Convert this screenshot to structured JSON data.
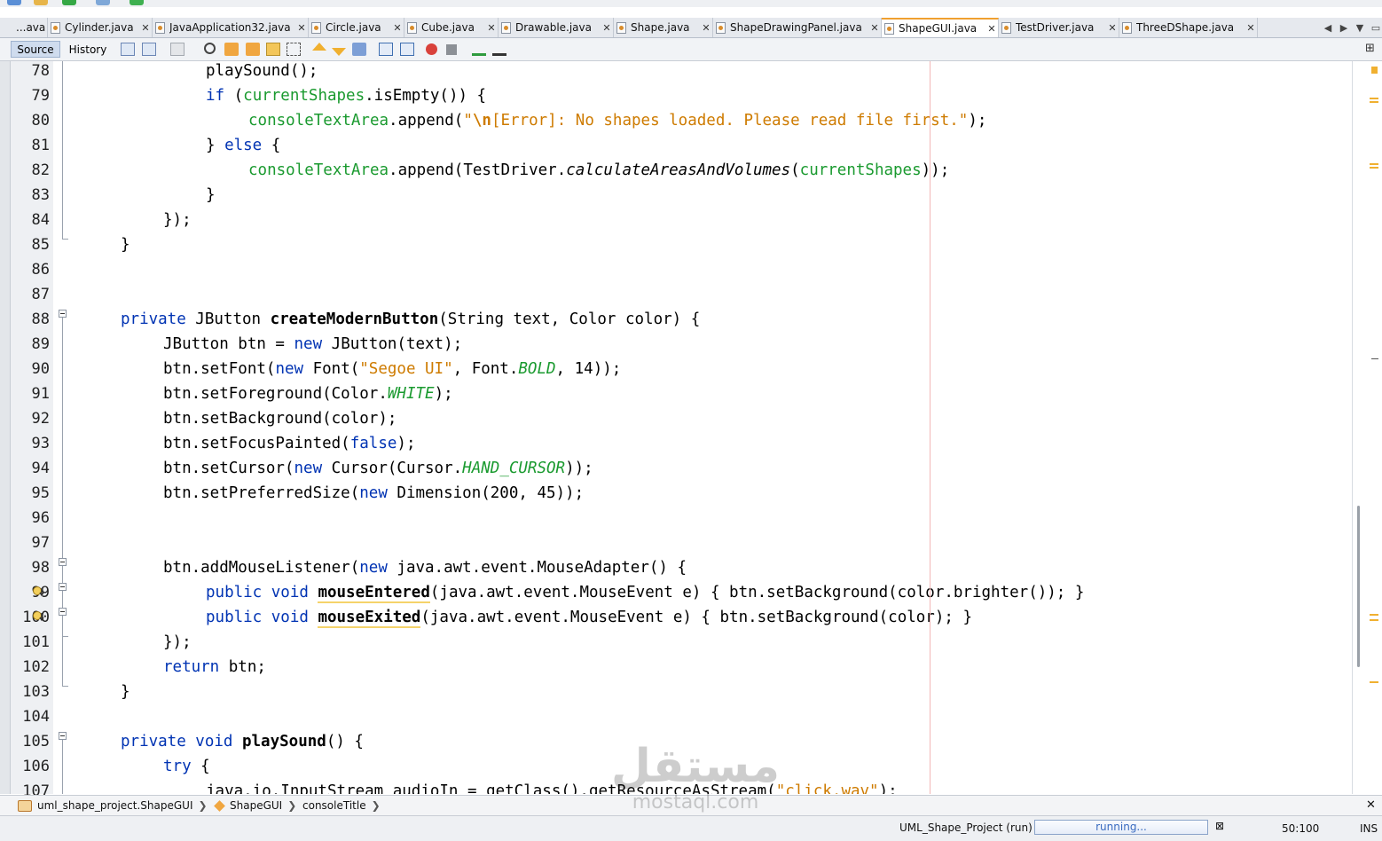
{
  "editor_tabs": [
    {
      "label": "...ava",
      "active": false
    },
    {
      "label": "Cylinder.java",
      "active": false
    },
    {
      "label": "JavaApplication32.java",
      "active": false
    },
    {
      "label": "Circle.java",
      "active": false
    },
    {
      "label": "Cube.java",
      "active": false
    },
    {
      "label": "Drawable.java",
      "active": false
    },
    {
      "label": "Shape.java",
      "active": false
    },
    {
      "label": "ShapeDrawingPanel.java",
      "active": false
    },
    {
      "label": "ShapeGUI.java",
      "active": true
    },
    {
      "label": "TestDriver.java",
      "active": false
    },
    {
      "label": "ThreeDShape.java",
      "active": false
    }
  ],
  "editor_toolbar": {
    "source_label": "Source",
    "history_label": "History"
  },
  "line_numbers": [
    "78",
    "79",
    "80",
    "81",
    "82",
    "83",
    "84",
    "85",
    "86",
    "87",
    "88",
    "89",
    "90",
    "91",
    "92",
    "93",
    "94",
    "95",
    "96",
    "97",
    "98",
    "99",
    "100",
    "101",
    "102",
    "103",
    "104",
    "105",
    "106",
    "107"
  ],
  "code": {
    "l78": "playSound();",
    "l79_kw": "if",
    "l79_f": "currentShapes",
    "l79_r": ".isEmpty()) {",
    "l80_f": "consoleTextArea",
    "l80_m": ".append(",
    "l80_q": "\"",
    "l80_esc": "\\n",
    "l80_s": "[Error]: No shapes loaded. Please read file first.\"",
    "l80_e": ");",
    "l81_a": "} ",
    "l81_kw": "else",
    "l81_b": " {",
    "l82_f": "consoleTextArea",
    "l82_m": ".append(TestDriver.",
    "l82_i": "calculateAreasAndVolumes",
    "l82_p": "(",
    "l82_f2": "currentShapes",
    "l82_e": "));",
    "l83": "}",
    "l84": "});",
    "l85": "}",
    "l88_kw": "private",
    "l88_t": " JButton ",
    "l88_n": "createModernButton",
    "l88_p": "(String text, Color color) {",
    "l89_a": "JButton btn = ",
    "l89_kw": "new",
    "l89_b": " JButton(text);",
    "l90_a": "btn.setFont(",
    "l90_kw": "new",
    "l90_b": " Font(",
    "l90_s": "\"Segoe UI\"",
    "l90_c": ", Font.",
    "l90_i": "BOLD",
    "l90_d": ", 14));",
    "l91_a": "btn.setForeground(Color.",
    "l91_i": "WHITE",
    "l91_b": ");",
    "l92": "btn.setBackground(color);",
    "l93_a": "btn.setFocusPainted(",
    "l93_kw": "false",
    "l93_b": ");",
    "l94_a": "btn.setCursor(",
    "l94_kw": "new",
    "l94_b": " Cursor(Cursor.",
    "l94_i": "HAND_CURSOR",
    "l94_c": "));",
    "l95_a": "btn.setPreferredSize(",
    "l95_kw": "new",
    "l95_b": " Dimension(200, 45));",
    "l98_a": "btn.addMouseListener(",
    "l98_kw": "new",
    "l98_b": " java.awt.event.MouseAdapter() {",
    "l99_kw": "public void",
    "l99_n": "mouseEntered",
    "l99_b": "(java.awt.event.MouseEvent e) { btn.setBackground(color.brighter()); }",
    "l100_kw": "public void",
    "l100_n": "mouseExited",
    "l100_b": "(java.awt.event.MouseEvent e) { btn.setBackground(color); }",
    "l101": "});",
    "l102_kw": "return",
    "l102_b": " btn;",
    "l103": "}",
    "l105_kw": "private void",
    "l105_n": "playSound",
    "l105_b": "() {",
    "l106_kw": "try",
    "l106_b": " {",
    "l107_a": "java.io.InputStream audioIn = getClass().getResourceAsStream(",
    "l107_s": "\"click.wav\"",
    "l107_b": ");"
  },
  "breadcrumb": [
    "uml_shape_project.ShapeGUI",
    "ShapeGUI",
    "consoleTitle"
  ],
  "status": {
    "project_label": "UML_Shape_Project (run)",
    "progress_text": "running...",
    "caret": "50:100",
    "mode": "INS"
  },
  "watermark": {
    "arabic": "مستقل",
    "latin": "mostaql.com"
  },
  "colors": {
    "keyword": "#0033b3",
    "field": "#1a9a2f",
    "string": "#ce7b00",
    "active_tab_accent": "#f0a030"
  }
}
